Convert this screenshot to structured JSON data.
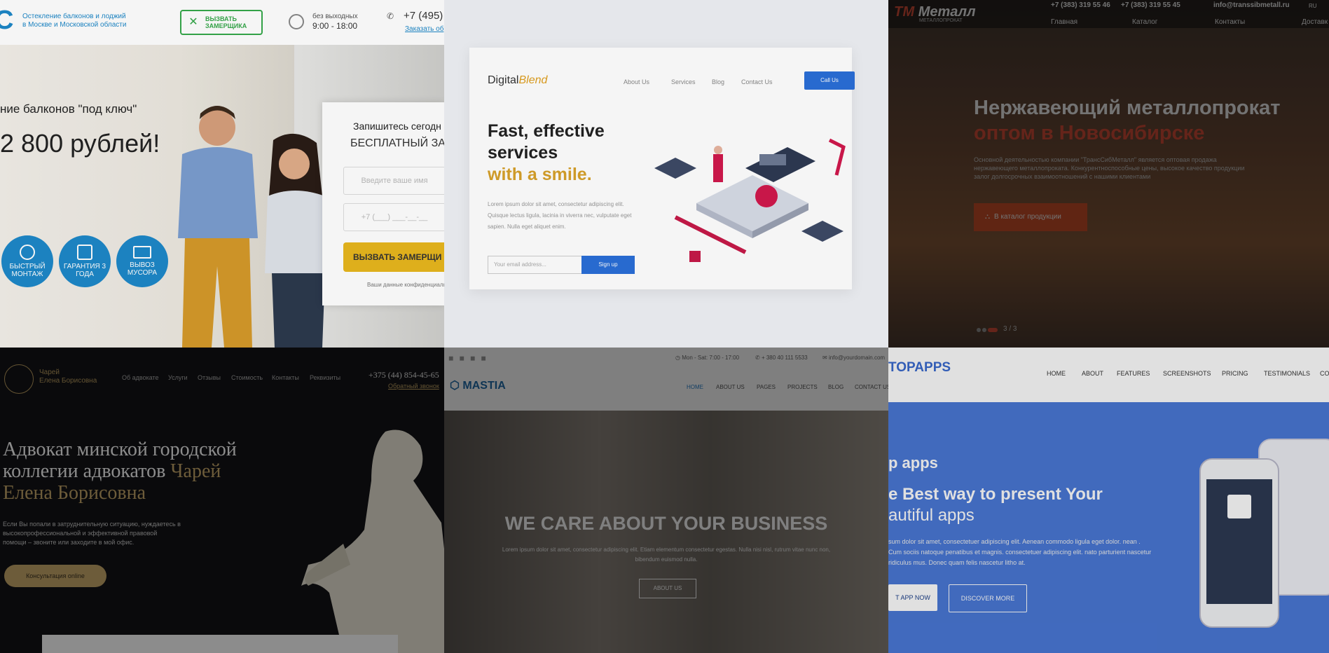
{
  "t1": {
    "logo_letter": "С",
    "tagline": [
      "Остекление балконов и лоджий",
      "в Москве и Московской области"
    ],
    "call_button": "ВЫЗВАТЬ ЗАМЕРЩИКА",
    "hours_label": "без выходных",
    "hours": "9:00 - 18:00",
    "phone": "+7 (495)",
    "order_link": "Заказать об",
    "hero_line1": "ние балконов \"под ключ\"",
    "hero_price": "2 800 рублей!",
    "features": [
      "БЫСТРЫЙ МОНТАЖ",
      "ГАРАНТИЯ 3 ГОДА",
      "ВЫВОЗ МУСОРА"
    ],
    "form_title1": "Запишитесь сегодн",
    "form_title2": "БЕСПЛАТНЫЙ ЗА",
    "form_name_placeholder": "Введите ваше имя",
    "form_phone_placeholder": "+7 (___) ___-__-__",
    "form_button": "ВЫЗВАТЬ ЗАМЕРЩИ",
    "form_note": "Ваши данные конфиденциальн"
  },
  "t2": {
    "logo_a": "Digital",
    "logo_b": "Blend",
    "nav": [
      "About Us",
      "Services",
      "Blog",
      "Contact Us"
    ],
    "call_button": "Call Us",
    "title1": "Fast, effective",
    "title2": "services",
    "title3": "with a smile.",
    "body": "Lorem ipsum dolor sit amet, consectetur adipiscing elit. Quisque lectus ligula, lacinia in viverra nec, vulputate eget sapien. Nulla eget aliquet enim.",
    "email_placeholder": "Your email address...",
    "signup": "Sign up"
  },
  "t3": {
    "logo_a": "ТМ",
    "logo_b": "Металл",
    "logo_sub": "МЕТАЛЛОПРОКАТ",
    "phones": [
      "+7 (383) 319 55 46",
      "+7 (383) 319 55 45"
    ],
    "email": "info@transsibmetall.ru",
    "nav": [
      "Главная",
      "Каталог",
      "Контакты",
      "Доставк"
    ],
    "title1": "Нержавеющий металлопрокат",
    "title2": "оптом в Новосибирске",
    "body": "Основной деятельностью компании \"ТрансСибМеталл\" является оптовая продажа нержавеющего металлопроката. Конкурентноспособные цены, высокое качество продукции залог долгосрочных взаимоотношений с нашими клиентами",
    "catalog_button": "В каталог продукции",
    "slider": "3 / 3",
    "ru": "RU"
  },
  "t4": {
    "logo_name_line1": "Чарей",
    "logo_name_line2": "Елена Борисовна",
    "nav": [
      "Об адвокате",
      "Услуги",
      "Отзывы",
      "Стоимость",
      "Контакты",
      "Реквизиты"
    ],
    "phone": "+375 (44) 854-45-65",
    "callback": "Обратный звонок",
    "title1": "Адвокат минской городской",
    "title2a": "коллегии адвокатов ",
    "title2b": "Чарей",
    "title3": "Елена Борисовна",
    "body": "Если Вы попали в затруднительную ситуацию, нуждаетесь в высокопрофессиональной и эффективной правовой помощи – звоните или заходите в мой офис.",
    "consult_button": "Консультация online"
  },
  "t5": {
    "topbar_hours": "Mon - Sat: 7:00 - 17:00",
    "topbar_phone": "+ 380 40 111 5533",
    "topbar_email": "info@yourdomain.com",
    "logo": "MASTIA",
    "nav": [
      "HOME",
      "ABOUT US",
      "PAGES",
      "PROJECTS",
      "BLOG",
      "CONTACT US"
    ],
    "title": "WE CARE ABOUT YOUR BUSINESS",
    "body": "Lorem ipsum dolor sit amet, consectetur adipiscing elit. Etiam elementum consectetur egestas. Nulla nisi nisl, rutrum vitae nunc non, bibendum euismod nulla.",
    "about_button": "ABOUT US"
  },
  "t6": {
    "logo": "TOPAPPS",
    "nav": [
      "HOME",
      "ABOUT",
      "FEATURES",
      "SCREENSHOTS",
      "PRICING",
      "TESTIMONIALS",
      "CO"
    ],
    "kicker": "p apps",
    "title1": "e Best way to present Your",
    "title2": "autiful apps",
    "body": "sum dolor sit amet, consectetuer adipiscing elit. Aenean commodo ligula eget dolor. nean . Cum sociis natoque penatibus et magnis. consectetuer adipiscing elit. nato parturient nascetur ridiculus mus. Donec quam felis nascetur litho at.",
    "get_button": "T APP NOW",
    "discover_button": "DISCOVER MORE"
  }
}
